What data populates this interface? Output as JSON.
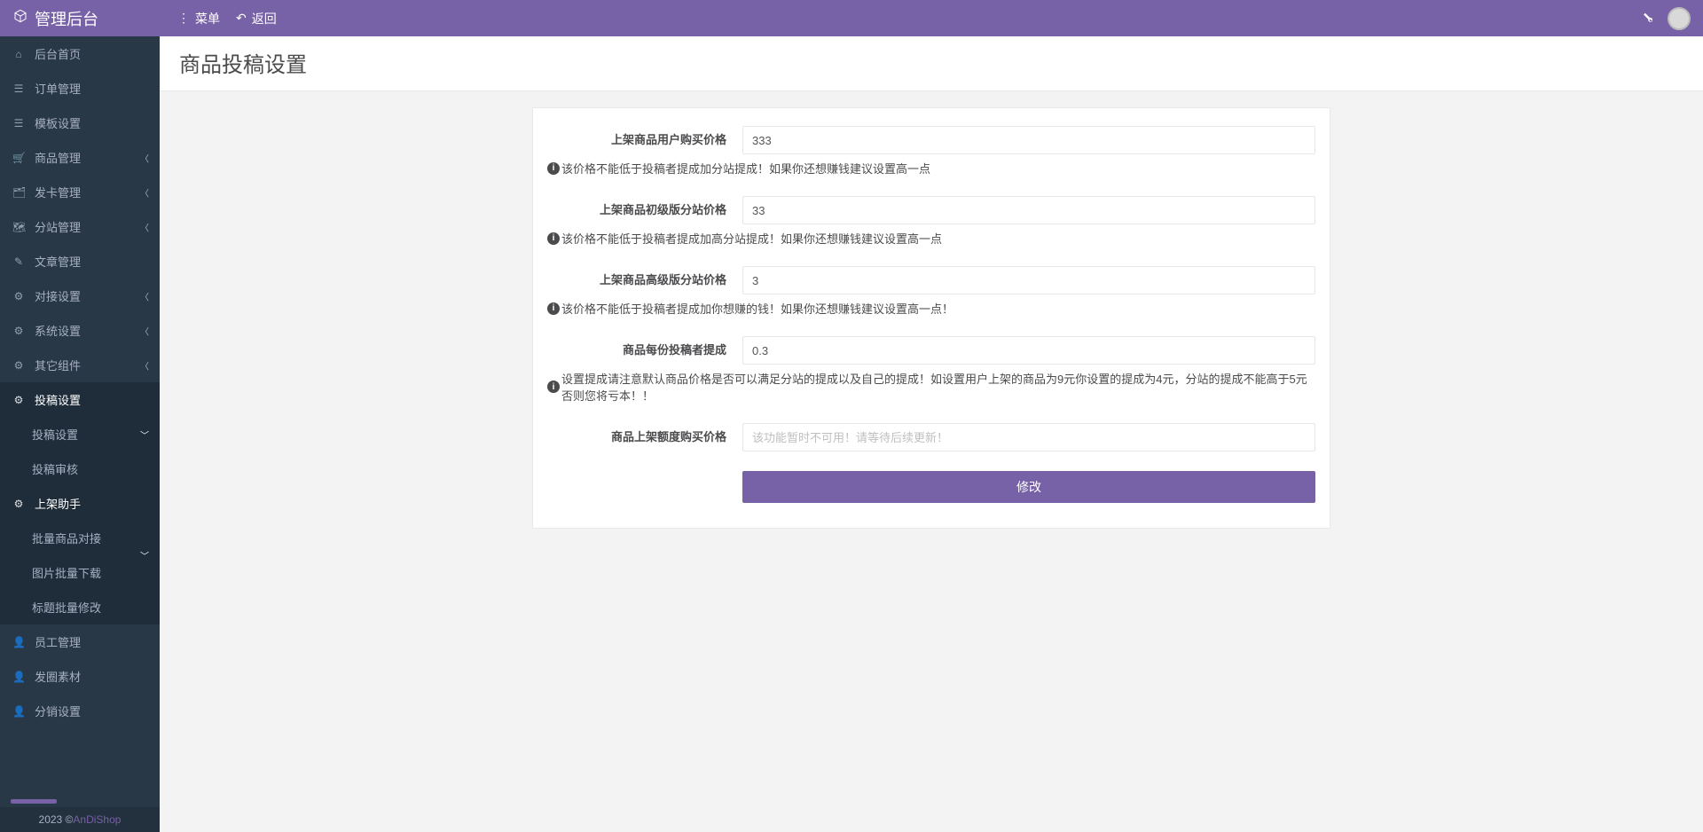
{
  "brand": "管理后台",
  "topbar": {
    "menu_label": "菜单",
    "back_label": "返回"
  },
  "sidebar": {
    "items": [
      {
        "label": "后台首页",
        "icon": "⌂"
      },
      {
        "label": "订单管理",
        "icon": "☰"
      },
      {
        "label": "模板设置",
        "icon": "☰"
      },
      {
        "label": "商品管理",
        "icon": "🛒",
        "expandable": true
      },
      {
        "label": "发卡管理",
        "icon": "🗂",
        "expandable": true
      },
      {
        "label": "分站管理",
        "icon": "🗺",
        "expandable": true
      },
      {
        "label": "文章管理",
        "icon": "✎"
      },
      {
        "label": "对接设置",
        "icon": "⚙",
        "expandable": true
      },
      {
        "label": "系统设置",
        "icon": "⚙",
        "expandable": true
      },
      {
        "label": "其它组件",
        "icon": "⚙",
        "expandable": true
      },
      {
        "label": "投稿设置",
        "icon": "⚙",
        "expandable": true,
        "active": true,
        "children": [
          "投稿设置",
          "投稿审核"
        ]
      },
      {
        "label": "上架助手",
        "icon": "⚙",
        "expandable": true,
        "active": true,
        "children": [
          "批量商品对接",
          "图片批量下载",
          "标题批量修改"
        ]
      },
      {
        "label": "员工管理",
        "icon": "👤"
      },
      {
        "label": "发圈素材",
        "icon": "👤"
      },
      {
        "label": "分销设置",
        "icon": "👤"
      }
    ],
    "footer_year": "2023 © ",
    "footer_link": "AnDiShop"
  },
  "page": {
    "title": "商品投稿设置",
    "fields": [
      {
        "label": "上架商品用户购买价格",
        "value": "333",
        "hint": "该价格不能低于投稿者提成加分站提成！如果你还想赚钱建议设置高一点"
      },
      {
        "label": "上架商品初级版分站价格",
        "value": "33",
        "hint": "该价格不能低于投稿者提成加高分站提成！如果你还想赚钱建议设置高一点"
      },
      {
        "label": "上架商品高级版分站价格",
        "value": "3",
        "hint": "该价格不能低于投稿者提成加你想赚的钱！如果你还想赚钱建议设置高一点！"
      },
      {
        "label": "商品每份投稿者提成",
        "value": "0.3",
        "hint": "设置提成请注意默认商品价格是否可以满足分站的提成以及自己的提成！如设置用户上架的商品为9元你设置的提成为4元，分站的提成不能高于5元否则您将亏本！！"
      },
      {
        "label": "商品上架额度购买价格",
        "value": "",
        "placeholder": "该功能暂时不可用！请等待后续更新！"
      }
    ],
    "submit_label": "修改"
  }
}
